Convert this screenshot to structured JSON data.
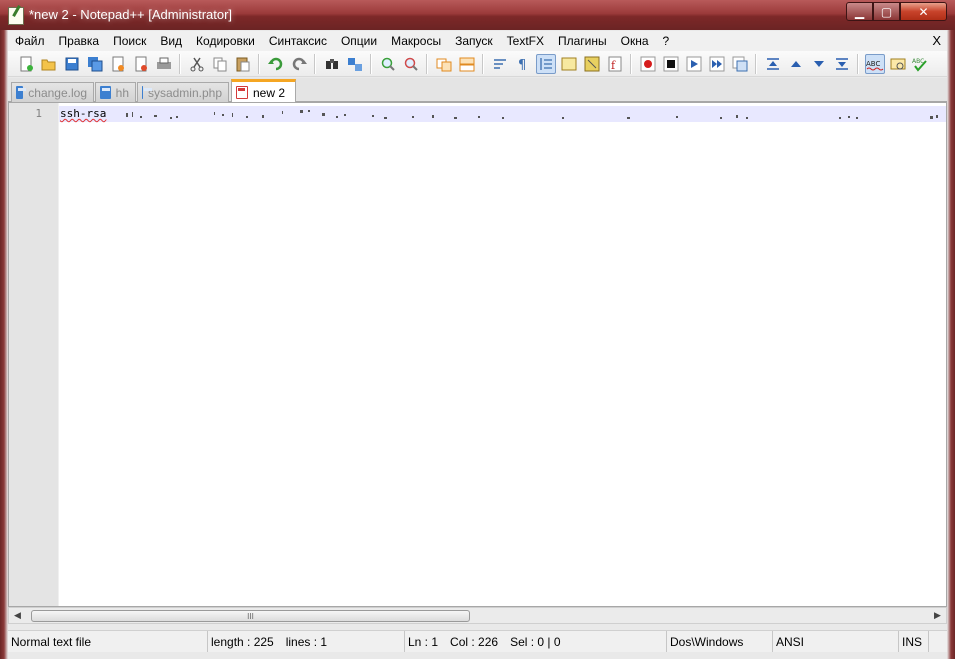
{
  "window": {
    "title": "*new  2 - Notepad++ [Administrator]",
    "controls": {
      "minimize": "▁",
      "maximize": "▢",
      "close": "✕"
    }
  },
  "menu": {
    "items": [
      "Файл",
      "Правка",
      "Поиск",
      "Вид",
      "Кодировки",
      "Синтаксис",
      "Опции",
      "Макросы",
      "Запуск",
      "TextFX",
      "Плагины",
      "Окна",
      "?"
    ],
    "close_label": "X"
  },
  "toolbar": {
    "icons": [
      "new-file-icon",
      "open-file-icon",
      "save-icon",
      "save-all-icon",
      "close-icon",
      "close-all-icon",
      "print-icon",
      "cut-icon",
      "copy-icon",
      "paste-icon",
      "undo-icon",
      "redo-icon",
      "find-icon",
      "replace-icon",
      "zoom-in-icon",
      "zoom-out-icon",
      "sync-vertical-icon",
      "sync-horizontal-icon",
      "word-wrap-icon",
      "show-all-chars-icon",
      "indent-guide-icon",
      "user-lang-icon",
      "doc-map-icon",
      "function-list-icon",
      "record-macro-icon",
      "stop-record-icon",
      "play-macro-icon",
      "run-multiple-macro-icon",
      "save-macro-icon",
      "fold-all-icon",
      "prev-icon",
      "next-icon",
      "unfold-all-icon",
      "spellcheck-icon",
      "text-icon",
      "check-icon"
    ]
  },
  "tabs": [
    {
      "label": "change.log",
      "active": false,
      "icon": "saved-file-icon"
    },
    {
      "label": "hh",
      "active": false,
      "icon": "saved-file-icon"
    },
    {
      "label": "sysadmin.php",
      "active": false,
      "icon": "saved-file-icon"
    },
    {
      "label": "new  2",
      "active": true,
      "icon": "unsaved-file-icon"
    }
  ],
  "editor": {
    "line_number": "1",
    "code_text": "ssh-rsa"
  },
  "scrollbar": {
    "left_arrow": "◀",
    "right_arrow": "▶",
    "grip": "III"
  },
  "status": {
    "file_type": "Normal text file",
    "length": "length : 225",
    "lines": "lines : 1",
    "ln": "Ln : 1",
    "col": "Col : 226",
    "sel": "Sel : 0 | 0",
    "eol": "Dos\\Windows",
    "encoding": "ANSI",
    "mode": "INS"
  },
  "colors": {
    "titlebar": "#8b3a3a",
    "active_tab_accent": "#f5a623",
    "current_line": "#e8e8ff",
    "spell_underline": "#e03030"
  }
}
